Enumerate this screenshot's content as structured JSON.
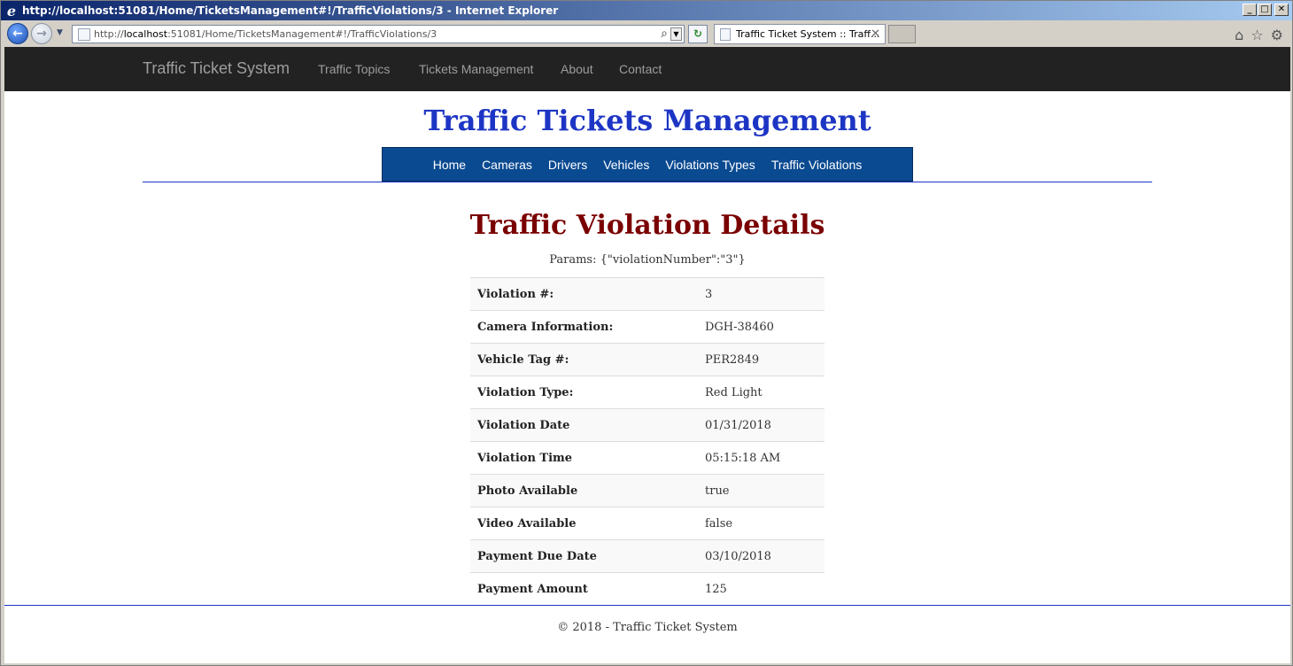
{
  "window": {
    "title": "http://localhost:51081/Home/TicketsManagement#!/TrafficViolations/3 - Internet Explorer",
    "buttons": {
      "minimize": "_",
      "maximize": "□",
      "close": "✕"
    }
  },
  "browser": {
    "url_prefix": "http://",
    "url_host": "localhost",
    "url_rest": ":51081/Home/TicketsManagement#!/TrafficViolations/3",
    "tab_title": "Traffic Ticket System :: Traff...",
    "icons": [
      "back-icon",
      "forward-icon",
      "search-icon",
      "refresh-icon",
      "home-icon",
      "favorites-icon",
      "settings-icon"
    ]
  },
  "topnav": {
    "brand": "Traffic Ticket System",
    "links": [
      "Traffic Topics",
      "Tickets Management",
      "About",
      "Contact"
    ]
  },
  "header": {
    "title": "Traffic Tickets Management"
  },
  "subnav": {
    "links": [
      "Home",
      "Cameras",
      "Drivers",
      "Vehicles",
      "Violations Types",
      "Traffic Violations"
    ]
  },
  "details": {
    "title": "Traffic Violation Details",
    "params": "Params: {\"violationNumber\":\"3\"}",
    "rows": [
      {
        "label": "Violation #:",
        "value": "3"
      },
      {
        "label": "Camera Information:",
        "value": "DGH-38460"
      },
      {
        "label": "Vehicle Tag #:",
        "value": "PER2849"
      },
      {
        "label": "Violation Type:",
        "value": "Red Light"
      },
      {
        "label": "Violation Date",
        "value": "01/31/2018"
      },
      {
        "label": "Violation Time",
        "value": "05:15:18 AM"
      },
      {
        "label": "Photo Available",
        "value": "true"
      },
      {
        "label": "Video Available",
        "value": "false"
      },
      {
        "label": "Payment Due Date",
        "value": "03/10/2018"
      },
      {
        "label": "Payment Amount",
        "value": "125"
      }
    ]
  },
  "footer": {
    "text": "© 2018 - Traffic Ticket System"
  },
  "colors": {
    "nav_bg": "#222222",
    "title_blue": "#1d35c4",
    "subnav_bg": "#0a4a91",
    "details_title": "#7a0000"
  }
}
